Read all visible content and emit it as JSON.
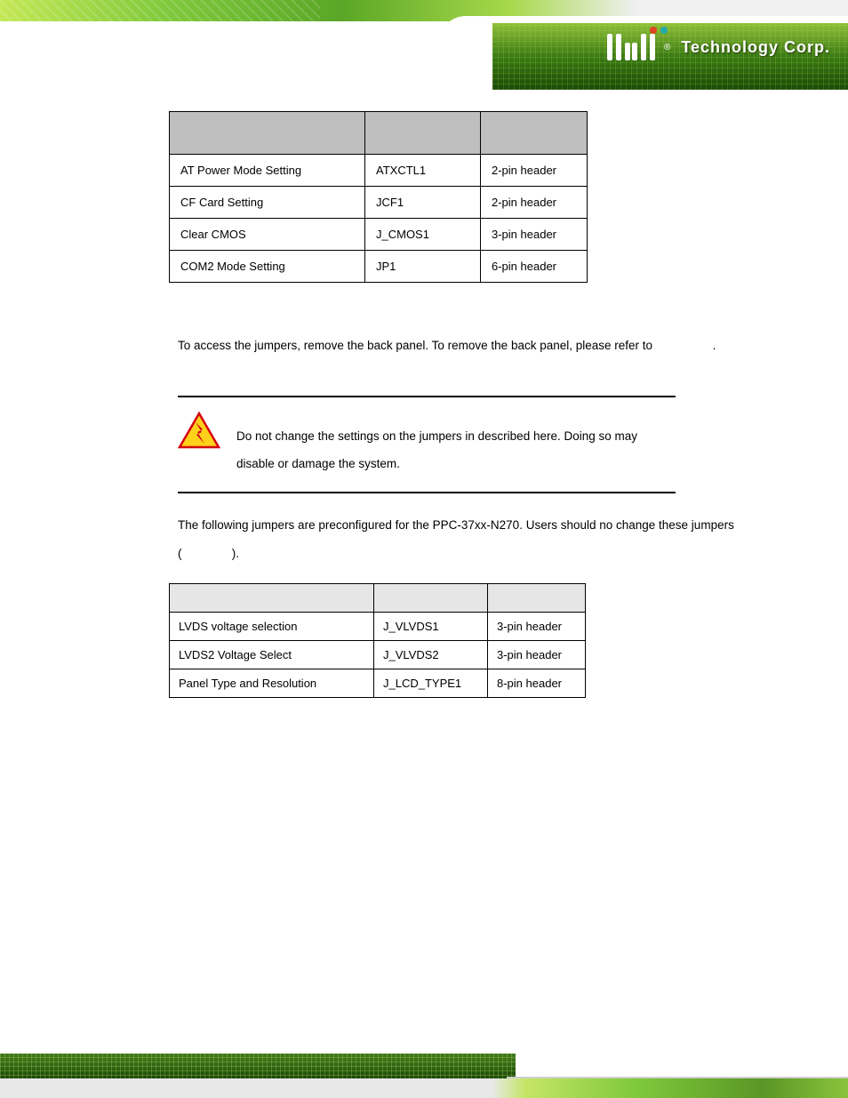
{
  "header": {
    "brand": "iEi",
    "reg": "®",
    "company": "Technology Corp."
  },
  "table1": {
    "headers": [
      "",
      "",
      ""
    ],
    "rows": [
      {
        "c0": "AT Power Mode Setting",
        "c1": "ATXCTL1",
        "c2": "2-pin header"
      },
      {
        "c0": "CF Card Setting",
        "c1": "JCF1",
        "c2": "2-pin header"
      },
      {
        "c0": "Clear CMOS",
        "c1": "J_CMOS1",
        "c2": "3-pin header"
      },
      {
        "c0": "COM2 Mode Setting",
        "c1": "JP1",
        "c2": "6-pin header"
      }
    ]
  },
  "paragraph1": "To access the jumpers, remove the back panel. To remove the back panel, please refer to",
  "paragraph1_after": ".",
  "warning": {
    "title": "",
    "text": "Do not change the settings on the jumpers in described here. Doing so may disable or damage the system."
  },
  "paragraph2_a": "The following jumpers are preconfigured for the PPC-37xx-N270. Users should no change these jumpers (",
  "paragraph2_b": ").",
  "table2": {
    "headers": [
      "",
      "",
      ""
    ],
    "rows": [
      {
        "c0": "LVDS voltage selection",
        "c1": "J_VLVDS1",
        "c2": "3-pin header"
      },
      {
        "c0": "LVDS2 Voltage Select",
        "c1": "J_VLVDS2",
        "c2": "3-pin header"
      },
      {
        "c0": "Panel Type and Resolution",
        "c1": "J_LCD_TYPE1",
        "c2": "8-pin header"
      }
    ]
  }
}
